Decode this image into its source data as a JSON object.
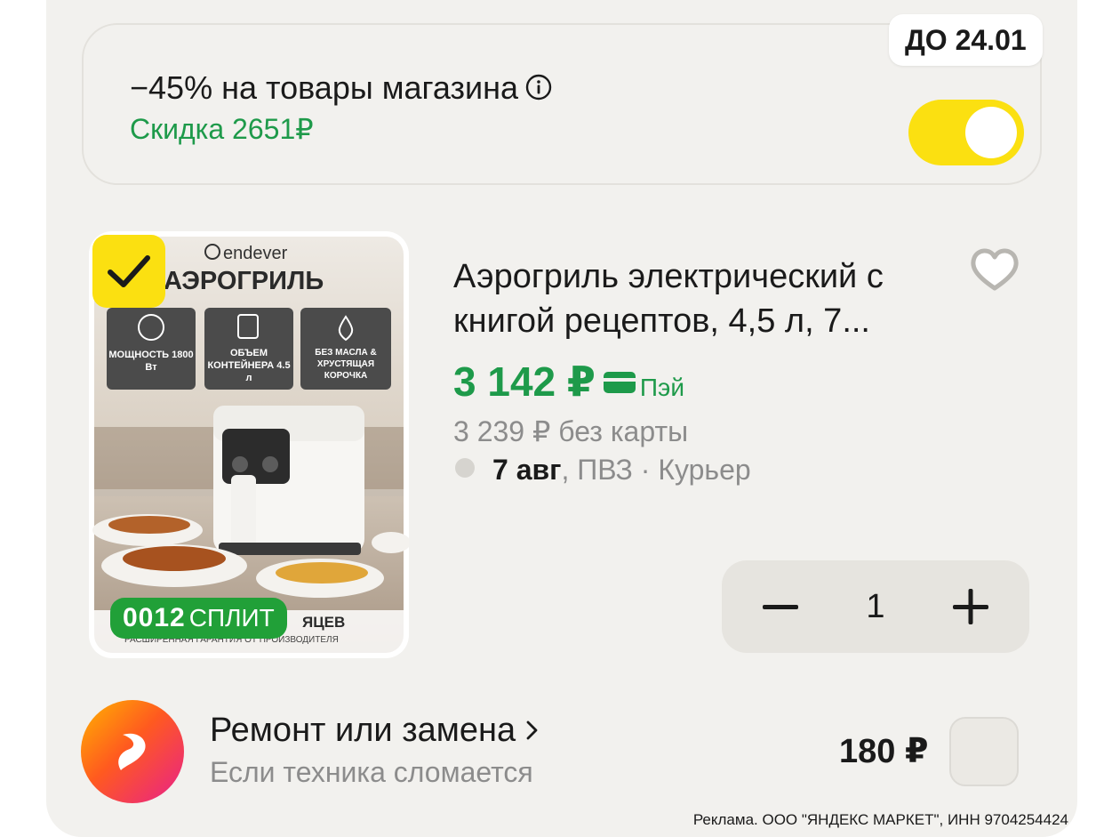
{
  "promo": {
    "title": "−45% на товары магазина",
    "discount": "Скидка 2651₽",
    "deadline": "ДО 24.01",
    "toggle_on": true
  },
  "product": {
    "image": {
      "brand": "endever",
      "headline": "АЭРОГРИЛЬ",
      "feature_1": "МОЩНОСТЬ 1800 Вт",
      "feature_2": "ОБЪЕМ КОНТЕЙНЕРА 4.5 л",
      "feature_3": "БЕЗ МАСЛА & ХРУСТЯЩАЯ КОРОЧКА",
      "footer_big": "ЯЦЕВ",
      "footer_small": "РАСШИРЕННАЯ ГАРАНТИЯ ОТ ПРОИЗВОДИТЕЛЯ"
    },
    "selected": true,
    "split_digits": "0012",
    "split_label": "СПЛИТ",
    "title": "Аэрогриль электрический с книгой рецептов, 4,5 л, 7...",
    "price": "3 142 ₽",
    "pay_label": "Пэй",
    "old_price": "3 239 ₽  без карты",
    "delivery_date": "7 авг",
    "delivery_rest": ", ПВЗ · Курьер",
    "quantity": "1"
  },
  "warranty": {
    "title": "Ремонт или замена",
    "subtitle": "Если техника сломается",
    "price": "180 ₽",
    "checked": false
  },
  "ad_text": "Реклама. ООО \"ЯНДЕКС МАРКЕТ\", ИНН 9704254424",
  "colors": {
    "accent_yellow": "#fbe011",
    "price_green": "#1e9a4a",
    "split_green": "#21a038",
    "background": "#f2f1ee"
  }
}
